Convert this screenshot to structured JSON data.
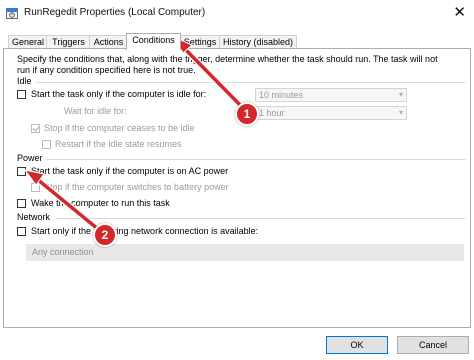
{
  "window": {
    "title": "RunRegedit Properties (Local Computer)",
    "close_glyph": "✕",
    "icon": "task-scheduler-icon"
  },
  "tabs": [
    {
      "label": "General",
      "active": false
    },
    {
      "label": "Triggers",
      "active": false
    },
    {
      "label": "Actions",
      "active": false
    },
    {
      "label": "Conditions",
      "active": true
    },
    {
      "label": "Settings",
      "active": false
    },
    {
      "label": "History (disabled)",
      "active": false
    }
  ],
  "description": {
    "line1": "Specify the conditions that, along with the trigger, determine whether the task should run.  The task will not",
    "line2": "run  if any condition specified here is not true."
  },
  "idle": {
    "group_label": "Idle",
    "start_if_idle": {
      "label": "Start the task only if the computer is idle for:",
      "checked": false
    },
    "idle_for_value": "10 minutes",
    "wait_label": "Wait for idle for:",
    "wait_value": "1 hour",
    "stop_if_not_idle": {
      "label": "Stop if the computer ceases to be idle",
      "checked": true
    },
    "restart_if_idle": {
      "label": "Restart if the idle state resumes",
      "checked": false
    }
  },
  "power": {
    "group_label": "Power",
    "ac_power": {
      "label": "Start the task only if the computer is on AC power",
      "checked": false
    },
    "battery": {
      "label": "Stop if the computer switches to battery power",
      "checked": false
    },
    "wake": {
      "label": "Wake the computer to run this task",
      "checked": false
    }
  },
  "network": {
    "group_label": "Network",
    "start_if_network": {
      "label": "Start only if the following network connection is available:",
      "checked": false
    },
    "connection_value": "Any connection"
  },
  "buttons": {
    "ok": "OK",
    "cancel": "Cancel"
  },
  "annotations": {
    "badge1": "1",
    "badge2": "2",
    "color": "#d3272a"
  }
}
